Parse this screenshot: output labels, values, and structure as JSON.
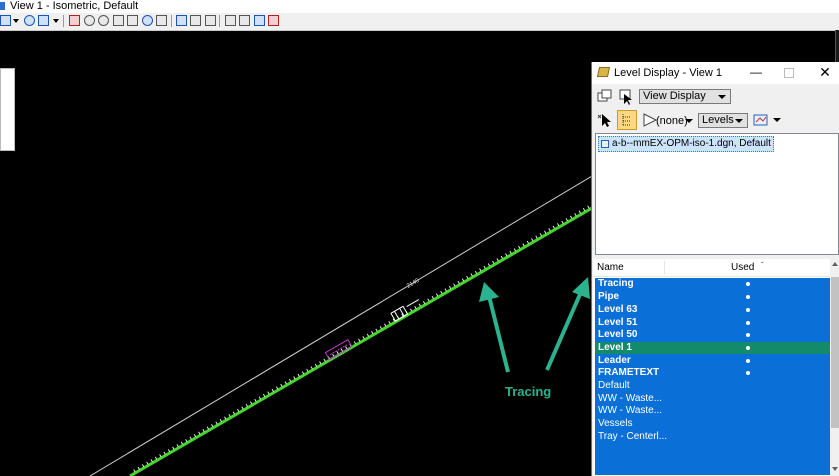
{
  "window": {
    "title": "View 1 - Isometric, Default"
  },
  "toolbar": {
    "icons": [
      "view-menu-icon",
      "dropdown-icon",
      "view-attributes-icon",
      "display-style-icon",
      "dropdown-icon",
      "update-view-icon",
      "zoom-in-icon",
      "zoom-out-icon",
      "window-area-icon",
      "fit-view-icon",
      "rotate-view-icon",
      "pan-view-icon",
      "view-previous-icon",
      "view-next-icon",
      "copy-view-icon",
      "camera-icon",
      "clip-volume-icon",
      "clip-mask-icon",
      "render-icon",
      "level-display-icon"
    ]
  },
  "drawing": {
    "labels": [
      "2140",
      "Tracing"
    ],
    "colors": {
      "background": "#000000",
      "pipe": "#44d62c",
      "reference_line": "#cfcfcf",
      "annotation": "#c13bc9",
      "arrow": "#2bb38f"
    }
  },
  "level_display": {
    "title": "Level Display - View 1",
    "minimize": "—",
    "close": "✕",
    "mode_dropdown": "View Display",
    "filter_dropdown": "(none)",
    "type_dropdown": "Levels",
    "tree_item": "a-b--mmEX-OPM-iso-1.dgn, Default",
    "columns": {
      "name": "Name",
      "used": "Used",
      "sort": "ˇ"
    },
    "levels": [
      {
        "name": "Tracing",
        "used": true,
        "active": false
      },
      {
        "name": "Pipe",
        "used": true,
        "active": false
      },
      {
        "name": "Level 63",
        "used": true,
        "active": false
      },
      {
        "name": "Level 51",
        "used": true,
        "active": false
      },
      {
        "name": "Level 50",
        "used": true,
        "active": false
      },
      {
        "name": "Level 1",
        "used": true,
        "active": true
      },
      {
        "name": "Leader",
        "used": true,
        "active": false
      },
      {
        "name": "FRAMETEXT",
        "used": true,
        "active": false
      },
      {
        "name": "Default",
        "used": false,
        "active": false
      },
      {
        "name": "WW - Waste...",
        "used": false,
        "active": false
      },
      {
        "name": "WW - Waste...",
        "used": false,
        "active": false
      },
      {
        "name": "Vessels",
        "used": false,
        "active": false
      },
      {
        "name": "Tray - Centerl...",
        "used": false,
        "active": false
      }
    ],
    "colors": {
      "selection": "#0a6fd6",
      "active_row": "#138a6a"
    }
  }
}
